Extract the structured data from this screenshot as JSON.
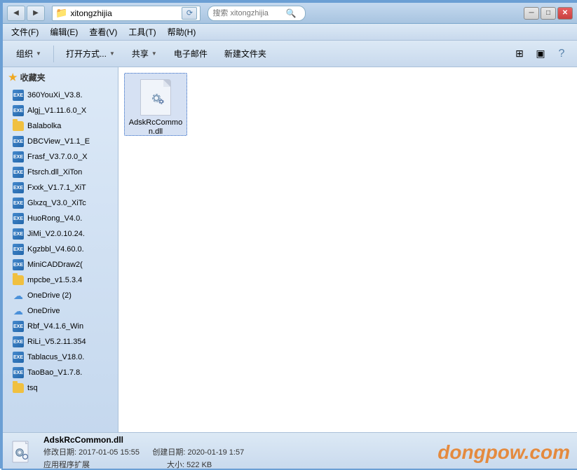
{
  "window": {
    "title": "xitongzhijia",
    "address": "xitongzhijia",
    "search_placeholder": "搜索 xitongzhijia"
  },
  "menu": {
    "items": [
      {
        "label": "文件(F)"
      },
      {
        "label": "编辑(E)"
      },
      {
        "label": "查看(V)"
      },
      {
        "label": "工具(T)"
      },
      {
        "label": "帮助(H)"
      }
    ]
  },
  "toolbar": {
    "organize": "组织",
    "open_with": "打开方式...",
    "share": "共享",
    "email": "电子邮件",
    "new_folder": "新建文件夹"
  },
  "sidebar": {
    "section_label": "收藏夹",
    "items": [
      {
        "label": "360YouXi_V3.8.",
        "type": "exe"
      },
      {
        "label": "Algj_V1.11.6.0_X",
        "type": "exe"
      },
      {
        "label": "Balabolka",
        "type": "folder"
      },
      {
        "label": "DBCView_V1.1_E",
        "type": "exe"
      },
      {
        "label": "Frasf_V3.7.0.0_X",
        "type": "exe"
      },
      {
        "label": "Ftsrch.dll_XiTon",
        "type": "exe"
      },
      {
        "label": "Fxxk_V1.7.1_XiT",
        "type": "exe"
      },
      {
        "label": "Glxzq_V3.0_XiTc",
        "type": "exe"
      },
      {
        "label": "HuoRong_V4.0.",
        "type": "exe"
      },
      {
        "label": "JiMi_V2.0.10.24.",
        "type": "exe"
      },
      {
        "label": "Kgzbbl_V4.60.0.",
        "type": "exe"
      },
      {
        "label": "MiniCADDraw2(",
        "type": "exe"
      },
      {
        "label": "mpcbe_v1.5.3.4",
        "type": "folder"
      },
      {
        "label": "OneDrive (2)",
        "type": "cloud"
      },
      {
        "label": "OneDrive",
        "type": "cloud"
      },
      {
        "label": "Rbf_V4.1.6_Win",
        "type": "exe"
      },
      {
        "label": "RiLi_V5.2.11.354",
        "type": "exe"
      },
      {
        "label": "Tablacus_V18.0.",
        "type": "exe"
      },
      {
        "label": "TaoBao_V1.7.8.",
        "type": "exe"
      },
      {
        "label": "tsq",
        "type": "folder"
      }
    ]
  },
  "content": {
    "files": [
      {
        "name": "AdskRcCommon.dll",
        "selected": true
      }
    ]
  },
  "status": {
    "filename": "AdskRcCommon.dll",
    "modify_label": "修改日期:",
    "modify_date": "2017-01-05 15:55",
    "create_label": "创建日期:",
    "create_date": "2020-01-19 1:57",
    "type_label": "应用程序扩展",
    "size_label": "大小:",
    "size_value": "522 KB"
  },
  "watermark": "dongpow.com"
}
